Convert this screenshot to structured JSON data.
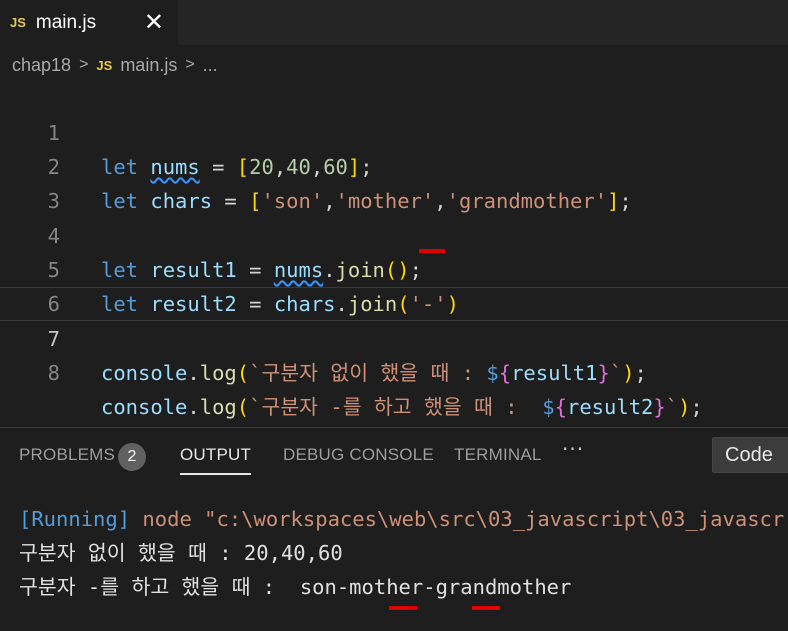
{
  "tab": {
    "badge": "JS",
    "title": "main.js",
    "close": "✕"
  },
  "breadcrumb": {
    "folder": "chap18",
    "badge": "JS",
    "file": "main.js",
    "more": "..."
  },
  "editor": {
    "line_numbers": [
      "1",
      "2",
      "3",
      "4",
      "5",
      "6",
      "7",
      "8"
    ],
    "active_line": "7",
    "lines": {
      "l1": {
        "kw": "let",
        "name": "nums",
        "eq": " = ",
        "ob": "[",
        "v1": "20",
        "c1": ",",
        "v2": "40",
        "c2": ",",
        "v3": "60",
        "cb": "]",
        "end": ";"
      },
      "l2": {
        "kw": "let",
        "name": "chars",
        "eq": " = ",
        "ob": "[",
        "s1": "'son'",
        "c1": ",",
        "s2": "'mother'",
        "c2": ",",
        "s3": "'grandmother'",
        "cb": "]",
        "end": ";"
      },
      "l4": {
        "kw": "let",
        "name": "result1",
        "eq": " = ",
        "obj": "nums",
        "dot": ".",
        "fn": "join",
        "args": "()",
        "end": ";"
      },
      "l5": {
        "kw": "let",
        "name": "result2",
        "eq": " = ",
        "obj": "chars",
        "dot": ".",
        "fn": "join",
        "op": "(",
        "arg": "'-'",
        "cp": ")"
      },
      "l7": {
        "obj": "console",
        "dot": ".",
        "fn": "log",
        "op": "(",
        "tpl": "`구분자 없이 했을 때 : ",
        "d": "$",
        "ob": "{",
        "var": "result1",
        "cb": "}",
        "tpl_end": "`",
        "cp": ")",
        "end": ";"
      },
      "l8": {
        "obj": "console",
        "dot": ".",
        "fn": "log",
        "op": "(",
        "tpl": "`구분자 -를 하고 했을 때 :  ",
        "d": "$",
        "ob": "{",
        "var": "result2",
        "cb": "}",
        "tpl_end": "`",
        "cp": ")",
        "end": ";"
      }
    }
  },
  "panel": {
    "tabs": [
      {
        "label": "PROBLEMS",
        "badge": "2"
      },
      {
        "label": "OUTPUT",
        "active": true
      },
      {
        "label": "DEBUG CONSOLE"
      },
      {
        "label": "TERMINAL"
      }
    ],
    "more": "···",
    "select_value": "Code",
    "output": {
      "running": "[Running]",
      "command": " node \"c:\\workspaces\\web\\src\\03_javascript\\03_javascr",
      "line1": "구분자 없이 했을 때 : 20,40,60",
      "line2": "구분자 -를 하고 했을 때 :  son-mother-grandmother"
    }
  },
  "colors": {
    "annotation": "#e00000",
    "keyword": "#569cd6",
    "string": "#ce9178",
    "function": "#dcdcaa"
  }
}
